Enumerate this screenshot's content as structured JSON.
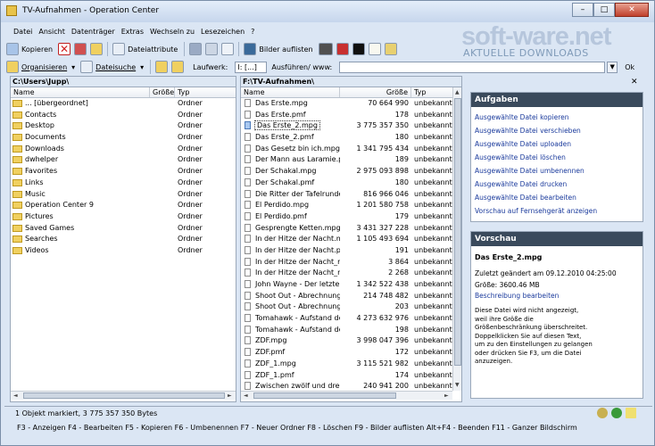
{
  "window": {
    "title": "TV-Aufnahmen - Operation Center"
  },
  "menu": [
    "Datei",
    "Ansicht",
    "Datenträger",
    "Extras",
    "Wechseln zu",
    "Lesezeichen",
    "?"
  ],
  "brand": {
    "logo_text": "soft-ware.net",
    "tagline": "AKTUELLE DOWNLOADS"
  },
  "toolbar": {
    "copy_label": "Kopieren",
    "attributes_label": "Dateiattribute",
    "show_images_label": "Bilder auflisten"
  },
  "toolbar2": {
    "organize_label": "Organisieren",
    "filesearch_label": "Dateisuche",
    "drive_label": "Laufwerk:",
    "drive_value": "I: [...]",
    "run_label": "Ausführen/ www:",
    "ok_label": "Ok"
  },
  "left_pane": {
    "path": "C:\\Users\\Jupp\\",
    "columns": [
      "Name",
      "Größe",
      "Typ"
    ],
    "items": [
      {
        "name": "... [übergeordnet]",
        "size": "",
        "type": "Ordner"
      },
      {
        "name": "Contacts",
        "size": "",
        "type": "Ordner"
      },
      {
        "name": "Desktop",
        "size": "",
        "type": "Ordner"
      },
      {
        "name": "Documents",
        "size": "",
        "type": "Ordner"
      },
      {
        "name": "Downloads",
        "size": "",
        "type": "Ordner"
      },
      {
        "name": "dwhelper",
        "size": "",
        "type": "Ordner"
      },
      {
        "name": "Favorites",
        "size": "",
        "type": "Ordner"
      },
      {
        "name": "Links",
        "size": "",
        "type": "Ordner"
      },
      {
        "name": "Music",
        "size": "",
        "type": "Ordner"
      },
      {
        "name": "Operation Center 9",
        "size": "",
        "type": "Ordner"
      },
      {
        "name": "Pictures",
        "size": "",
        "type": "Ordner"
      },
      {
        "name": "Saved Games",
        "size": "",
        "type": "Ordner"
      },
      {
        "name": "Searches",
        "size": "",
        "type": "Ordner"
      },
      {
        "name": "Videos",
        "size": "",
        "type": "Ordner"
      }
    ]
  },
  "right_pane": {
    "path": "F:\\TV-Aufnahmen\\",
    "columns": [
      "Name",
      "Größe",
      "Typ"
    ],
    "items": [
      {
        "name": "Das Erste.mpg",
        "size": "70 664 990",
        "type": "unbekannt"
      },
      {
        "name": "Das Erste.pmf",
        "size": "178",
        "type": "unbekannt"
      },
      {
        "name": "Das Erste_2.mpg",
        "size": "3 775 357 350",
        "type": "unbekannt",
        "selected": true
      },
      {
        "name": "Das Erste_2.pmf",
        "size": "180",
        "type": "unbekannt"
      },
      {
        "name": "Das Gesetz bin ich.mpg",
        "size": "1 341 795 434",
        "type": "unbekannt"
      },
      {
        "name": "Der Mann aus Laramie.pmf",
        "size": "189",
        "type": "unbekannt"
      },
      {
        "name": "Der Schakal.mpg",
        "size": "2 975 093 898",
        "type": "unbekannt"
      },
      {
        "name": "Der Schakal.pmf",
        "size": "180",
        "type": "unbekannt"
      },
      {
        "name": "Die Ritter der Tafelrunde.m...",
        "size": "816 966 046",
        "type": "unbekannt"
      },
      {
        "name": "El Perdido.mpg",
        "size": "1 201 580 758",
        "type": "unbekannt"
      },
      {
        "name": "El Perdido.pmf",
        "size": "179",
        "type": "unbekannt"
      },
      {
        "name": "Gesprengte Ketten.mpg",
        "size": "3 431 327 228",
        "type": "unbekannt"
      },
      {
        "name": "In der Hitze der Nacht.mpg",
        "size": "1 105 493 694",
        "type": "unbekannt"
      },
      {
        "name": "In der Hitze der Nacht.pmf",
        "size": "191",
        "type": "unbekannt"
      },
      {
        "name": "In der Hitze der Nacht_mp...",
        "size": "3 864",
        "type": "unbekannt"
      },
      {
        "name": "In der Hitze der Nacht_mp...",
        "size": "2 268",
        "type": "unbekannt"
      },
      {
        "name": "John Wayne - Der letzte B...",
        "size": "1 342 522 438",
        "type": "unbekannt"
      },
      {
        "name": "Shoot Out - Abrechnung in...",
        "size": "214 748 482",
        "type": "unbekannt"
      },
      {
        "name": "Shoot Out - Abrechnung in...",
        "size": "203",
        "type": "unbekannt"
      },
      {
        "name": "Tomahawk - Aufstand der ...",
        "size": "4 273 632 976",
        "type": "unbekannt"
      },
      {
        "name": "Tomahawk - Aufstand der ...",
        "size": "198",
        "type": "unbekannt"
      },
      {
        "name": "ZDF.mpg",
        "size": "3 998 047 396",
        "type": "unbekannt"
      },
      {
        "name": "ZDF.pmf",
        "size": "172",
        "type": "unbekannt"
      },
      {
        "name": "ZDF_1.mpg",
        "size": "3 115 521 982",
        "type": "unbekannt"
      },
      {
        "name": "ZDF_1.pmf",
        "size": "174",
        "type": "unbekannt"
      },
      {
        "name": "Zwischen zwölf und drei.mpg",
        "size": "240 941 200",
        "type": "unbekannt"
      }
    ]
  },
  "tasks": {
    "title": "Aufgaben",
    "items": [
      "Ausgewählte Datei kopieren",
      "Ausgewählte Datei verschieben",
      "Ausgewählte Datei uploaden",
      "Ausgewählte Datei löschen",
      "Ausgewählte Datei umbenennen",
      "Ausgewählte Datei drucken",
      "Ausgewählte Datei bearbeiten",
      "Vorschau auf Fernsehgerät anzeigen"
    ]
  },
  "preview": {
    "title": "Vorschau",
    "filename": "Das Erste_2.mpg",
    "modified": "Zuletzt geändert am 09.12.2010 04:25:00",
    "size": "Größe: 3600.46 MB",
    "edit_link": "Beschreibung bearbeiten",
    "note": "Diese Datei wird nicht angezeigt, weil ihre Größe die Größenbeschränkung überschreitet. Doppelklicken Sie auf diesen Text, um zu den Einstellungen zu gelangen oder drücken Sie F3, um die Datei anzuzeigen."
  },
  "status": {
    "text": "1 Objekt markiert, 3 775 357 350 Bytes"
  },
  "fkeys": "F3 - Anzeigen   F4 - Bearbeiten   F5 - Kopieren   F6 - Umbenennen   F7 - Neuer Ordner   F8 - Löschen   F9 - Bilder auflisten   Alt+F4 - Beenden   F11 - Ganzer Bildschirm",
  "colors": {
    "accent": "#1a3a9c",
    "panel_header": "#3a4a5c",
    "window_bg": "#dbe6f4"
  }
}
